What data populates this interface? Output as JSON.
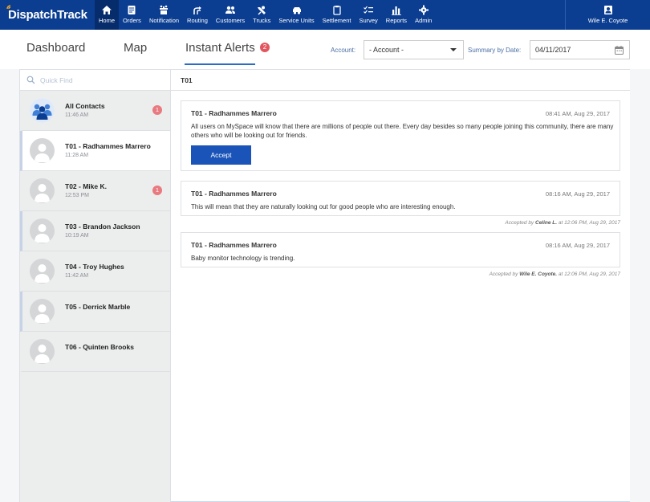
{
  "app": {
    "logo_text": "DispatchTrack"
  },
  "nav": {
    "items": [
      {
        "label": "Home",
        "icon": "home-icon"
      },
      {
        "label": "Orders",
        "icon": "orders-icon"
      },
      {
        "label": "Notification",
        "icon": "notification-icon"
      },
      {
        "label": "Routing",
        "icon": "routing-icon"
      },
      {
        "label": "Customers",
        "icon": "customers-icon"
      },
      {
        "label": "Trucks",
        "icon": "trucks-icon"
      },
      {
        "label": "Service Units",
        "icon": "service-units-icon"
      },
      {
        "label": "Settlement",
        "icon": "settlement-icon"
      },
      {
        "label": "Survey",
        "icon": "survey-icon"
      },
      {
        "label": "Reports",
        "icon": "reports-icon"
      },
      {
        "label": "Admin",
        "icon": "gear-icon"
      }
    ],
    "user": "Wile E. Coyote"
  },
  "tabs": [
    {
      "label": "Dashboard"
    },
    {
      "label": "Map"
    },
    {
      "label": "Instant Alerts",
      "badge": "2"
    }
  ],
  "filters": {
    "account_label": "Account:",
    "account_value": "- Account -",
    "date_label": "Summary by Date:",
    "date_value": "04/11/2017"
  },
  "sidebar": {
    "search_placeholder": "Quick Find",
    "contacts": [
      {
        "name": "All Contacts",
        "time": "11:46 AM",
        "badge": "1"
      },
      {
        "name": "T01 - Radhammes Marrero",
        "time": "11:28 AM",
        "badge": ""
      },
      {
        "name": "T02 - Mike K.",
        "time": "12:53 PM",
        "badge": "1"
      },
      {
        "name": "T03 - Brandon Jackson",
        "time": "10:19 AM",
        "badge": ""
      },
      {
        "name": "T04 - Troy Hughes",
        "time": "11:42 AM",
        "badge": ""
      },
      {
        "name": "T05 - Derrick Marble",
        "time": "",
        "badge": ""
      },
      {
        "name": "T06 - Quinten Brooks",
        "time": "",
        "badge": ""
      }
    ]
  },
  "content": {
    "header": "T01",
    "alerts": [
      {
        "title": "T01 - Radhammes Marrero",
        "time": "08:41 AM, Aug 29, 2017",
        "text": "All users on MySpace will know that there are millions of people out there. Every day besides so many people joining this community, there are many others who will be looking out for friends.",
        "button": "Accept"
      },
      {
        "title": "T01 - Radhammes Marrero",
        "time": "08:16 AM, Aug 29, 2017",
        "text": "This will mean that they are naturally looking out for good people who are interesting enough.",
        "accepted_prefix": "Accepted by",
        "accepted_by": "Celine L.",
        "accepted_at": "at 12:06 PM, Aug 29, 2017"
      },
      {
        "title": "T01 - Radhammes Marrero",
        "time": "08:16 AM, Aug 29, 2017",
        "text": "Baby monitor technology is trending.",
        "accepted_prefix": "Accepted by",
        "accepted_by": "Wile E. Coyote.",
        "accepted_at": "at 12:06 PM, Aug 29, 2017"
      }
    ]
  },
  "colors": {
    "nav_bg": "#0b3d91",
    "accent": "#1b54b8",
    "badge": "#e2555e"
  }
}
